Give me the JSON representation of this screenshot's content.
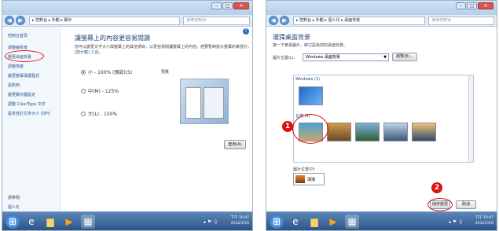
{
  "left": {
    "address": "▸ 控制台 ▸ 外觀 ▸ 顯示",
    "search_placeholder": "搜尋控制台",
    "sidebar": [
      {
        "label": "控制台首頁"
      },
      {
        "label": "調整解析度"
      },
      {
        "label": "變更桌面背景"
      },
      {
        "label": "調整亮度"
      },
      {
        "label": "變更螢幕保護程式"
      },
      {
        "label": "投影到"
      },
      {
        "label": "變更顯示器設定"
      },
      {
        "label": "調整 ClearType 文字"
      },
      {
        "label": "設定自訂文字大小 (DPI)"
      }
    ],
    "see_also": "請參閱",
    "see_also_link": "個人化",
    "heading": "讓螢幕上的內容更容易閱讀",
    "desc1": "您可以變更文字大小與螢幕上的其他項目，以更容易閱讀螢幕上的內容。若要暫時放大螢幕的某部分，請使用",
    "desc2": "[放大鏡] 工具。",
    "options": [
      {
        "label": "小 - 100% (預設)(S)",
        "selected": true
      },
      {
        "label": "中(M) - 125%",
        "selected": false
      },
      {
        "label": "大(L) - 150%",
        "selected": false
      }
    ],
    "preview_label": "預覽",
    "apply_label": "套用(A)",
    "clock_time": "下午 10:47",
    "clock_date": "2012/5/16"
  },
  "right": {
    "address": "▸ 控制台 ▸ 外觀 ▸ 個人化 ▸ 桌面背景",
    "search_placeholder": "搜尋控制台",
    "heading": "選擇桌面背景",
    "desc": "按一下某張圖片，將它設為您的桌面背景。",
    "location_label": "圖片位置(L):",
    "location_value": "Windows 桌面背景",
    "browse_label": "瀏覽(B)...",
    "group1": "Windows (1)",
    "group2": "台灣 (6)",
    "position_label": "圖片位置(P):",
    "position_value": "填滿",
    "save_label": "儲存變更",
    "cancel_label": "取消",
    "annotation1": "1",
    "annotation2": "2",
    "clock_time": "下午 10:47",
    "clock_date": "2012/5/16"
  },
  "colors": {
    "annotation": "#dd1111",
    "link": "#1b4f8c",
    "heading": "#1e3f78"
  }
}
